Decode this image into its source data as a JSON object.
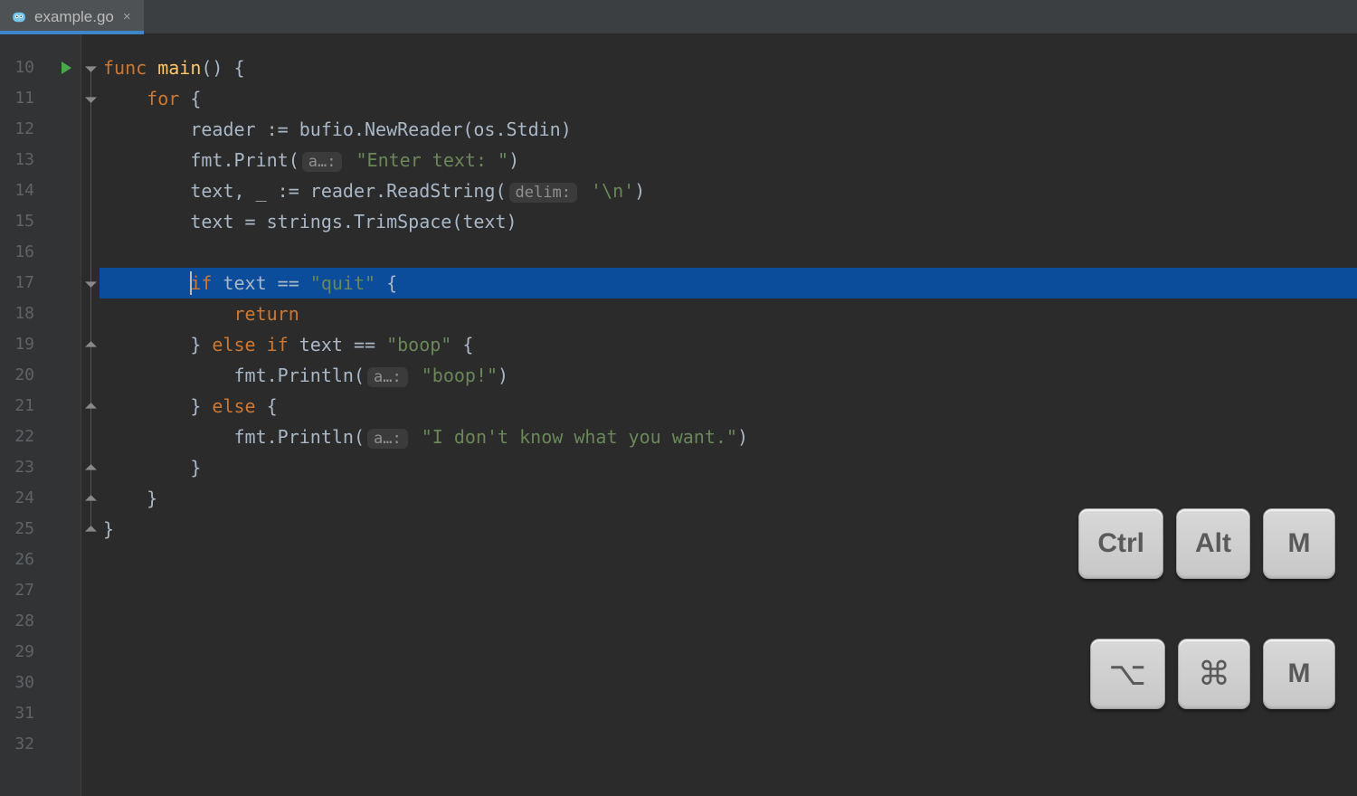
{
  "tab": {
    "filename": "example.go",
    "close_glyph": "×"
  },
  "line_numbers": [
    "10",
    "11",
    "12",
    "13",
    "14",
    "15",
    "16",
    "17",
    "18",
    "19",
    "20",
    "21",
    "22",
    "23",
    "24",
    "25",
    "26",
    "27",
    "28",
    "29",
    "30",
    "31",
    "32"
  ],
  "highlighted_index": 7,
  "code": {
    "l10": {
      "indent": "",
      "kw": "func ",
      "name": "main",
      "rest": "() {"
    },
    "l11": {
      "indent": "    ",
      "kw": "for ",
      "rest": "{"
    },
    "l12": {
      "indent": "        ",
      "text": "reader := bufio.NewReader(os.Stdin)"
    },
    "l13": {
      "indent": "        ",
      "pre": "fmt.Print(",
      "hint": "a…:",
      "str": " \"Enter text: \"",
      "post": ")"
    },
    "l14": {
      "indent": "        ",
      "pre": "text, _ := reader.ReadString(",
      "hint": "delim:",
      "str": " '\\n'",
      "post": ")"
    },
    "l15": {
      "indent": "        ",
      "text": "text = strings.TrimSpace(text)"
    },
    "l16": {
      "indent": ""
    },
    "l17": {
      "indent": "        ",
      "kw1": "if ",
      "mid": "text == ",
      "str": "\"quit\"",
      "rest": " {"
    },
    "l18": {
      "indent": "            ",
      "kw": "return"
    },
    "l19": {
      "indent": "        ",
      "pre": "} ",
      "kw1": "else if ",
      "mid": "text == ",
      "str": "\"boop\"",
      "rest": " {"
    },
    "l20": {
      "indent": "            ",
      "pre": "fmt.Println(",
      "hint": "a…:",
      "str": " \"boop!\"",
      "post": ")"
    },
    "l21": {
      "indent": "        ",
      "pre": "} ",
      "kw": "else ",
      "rest": "{"
    },
    "l22": {
      "indent": "            ",
      "pre": "fmt.Println(",
      "hint": "a…:",
      "str": " \"I don't know what you want.\"",
      "post": ")"
    },
    "l23": {
      "indent": "        ",
      "text": "}"
    },
    "l24": {
      "indent": "    ",
      "text": "}"
    },
    "l25": {
      "indent": "",
      "text": "}"
    }
  },
  "keys": {
    "top": [
      "Ctrl",
      "Alt",
      "M"
    ],
    "bot": [
      "⌥",
      "⌘",
      "M"
    ]
  }
}
